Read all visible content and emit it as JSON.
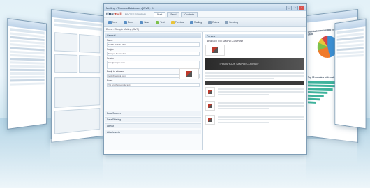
{
  "main_window": {
    "title": "Mailing - Thomas Brickmann [GVS] - X",
    "brand_prefix": "tine",
    "brand_suffix": "mail",
    "edition": "PROFESSIONAL",
    "tabs": [
      "Start",
      "Send",
      "Contacts"
    ],
    "ribbon": [
      "New",
      "Send",
      "Save",
      "Test",
      "Preview",
      "Mailing",
      "Rules",
      "Sending"
    ],
    "address": "Demo - Sample Mailing (GVS)",
    "left_section": "General",
    "fields": [
      {
        "label": "Name",
        "value": "SAMPLE MAILING"
      },
      {
        "label": "Subject",
        "value": "Sample Newsletter"
      },
      {
        "label": "Sender",
        "value": "info@sample.com"
      },
      {
        "label": "Reply-to address",
        "value": "reply@sample.com"
      },
      {
        "label": "Notes",
        "value": "Yet another sample text"
      }
    ],
    "collapsed_sections": [
      "Data Sources",
      "Data Filtering",
      "Layout",
      "Attachments"
    ],
    "right_header": "Preview",
    "preview_title": "NEWSLETTER SAMPLE COMPANY",
    "banner_text": "THIS IS YOUR SAMPLE COMPANY",
    "logo_label": "SAMPLE COMPANY"
  },
  "chart_window": {
    "title1": "Distribution according to the type of email client",
    "title2": "Top 10 domains with mobile clients"
  },
  "colors": {
    "accent": "#3b8fd3",
    "brand_red": "#c0392b"
  },
  "icons": [
    "window-close-icon",
    "new-icon",
    "send-icon",
    "save-icon"
  ]
}
